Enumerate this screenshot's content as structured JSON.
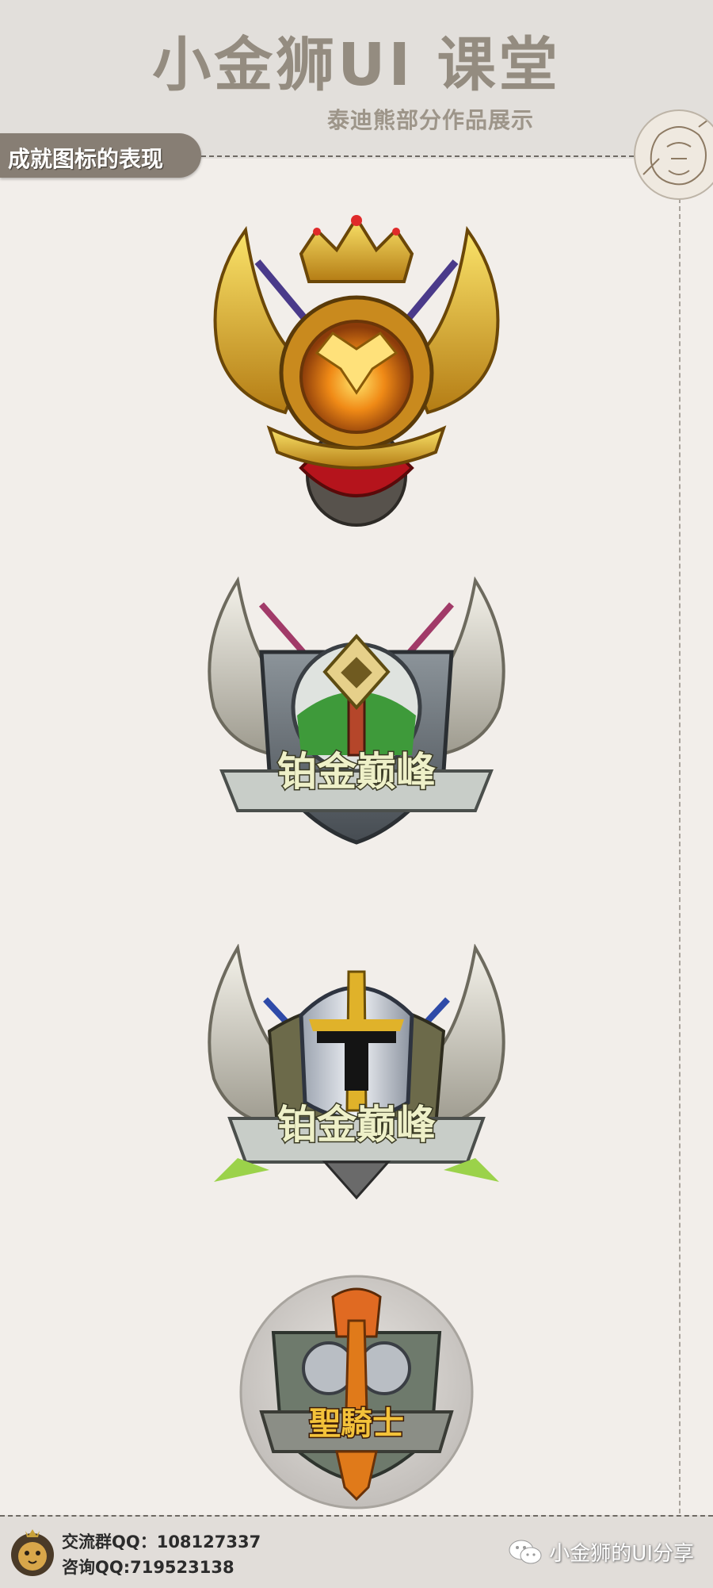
{
  "header": {
    "title": "小金狮UI 课堂",
    "subtitle": "泰迪熊部分作品展示"
  },
  "section": {
    "tab_label": "成就图标的表现"
  },
  "badges": [
    {
      "icon": "golden-winged-crown-badge",
      "label": ""
    },
    {
      "icon": "platinum-shield-badge",
      "label": "铂金巅峰"
    },
    {
      "icon": "knight-helmet-badge",
      "label": "铂金巅峰"
    },
    {
      "icon": "paladin-round-badge",
      "label": "聖騎士"
    }
  ],
  "footer": {
    "group_qq": "交流群QQ：108127337",
    "consult_qq": "咨询QQ:719523138",
    "wechat_account": "小金狮的UI分享"
  },
  "colors": {
    "background": "#f2eeea",
    "header_bg": "#e2dfdb",
    "title": "#948c80",
    "tab_bg": "#877e74",
    "gold": "#d9a520",
    "silver": "#c9ccc8"
  }
}
